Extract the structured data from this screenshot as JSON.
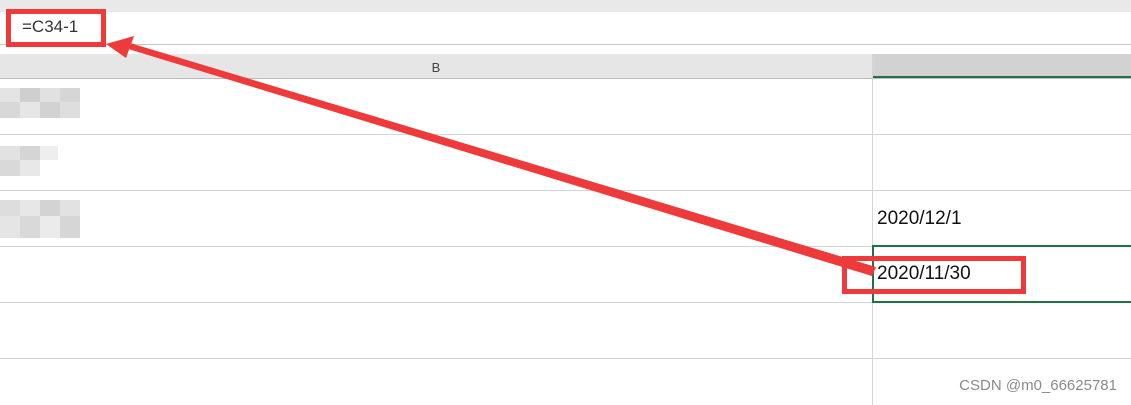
{
  "formula_bar": {
    "content": "=C34-1"
  },
  "columns": {
    "b_label": "B"
  },
  "cells": {
    "c_row3": "2020/12/1",
    "c_row4": "2020/11/30"
  },
  "watermark": "CSDN @m0_66625781",
  "annotation": {
    "color": "#ee3a3a"
  },
  "accent_color": "#217346"
}
